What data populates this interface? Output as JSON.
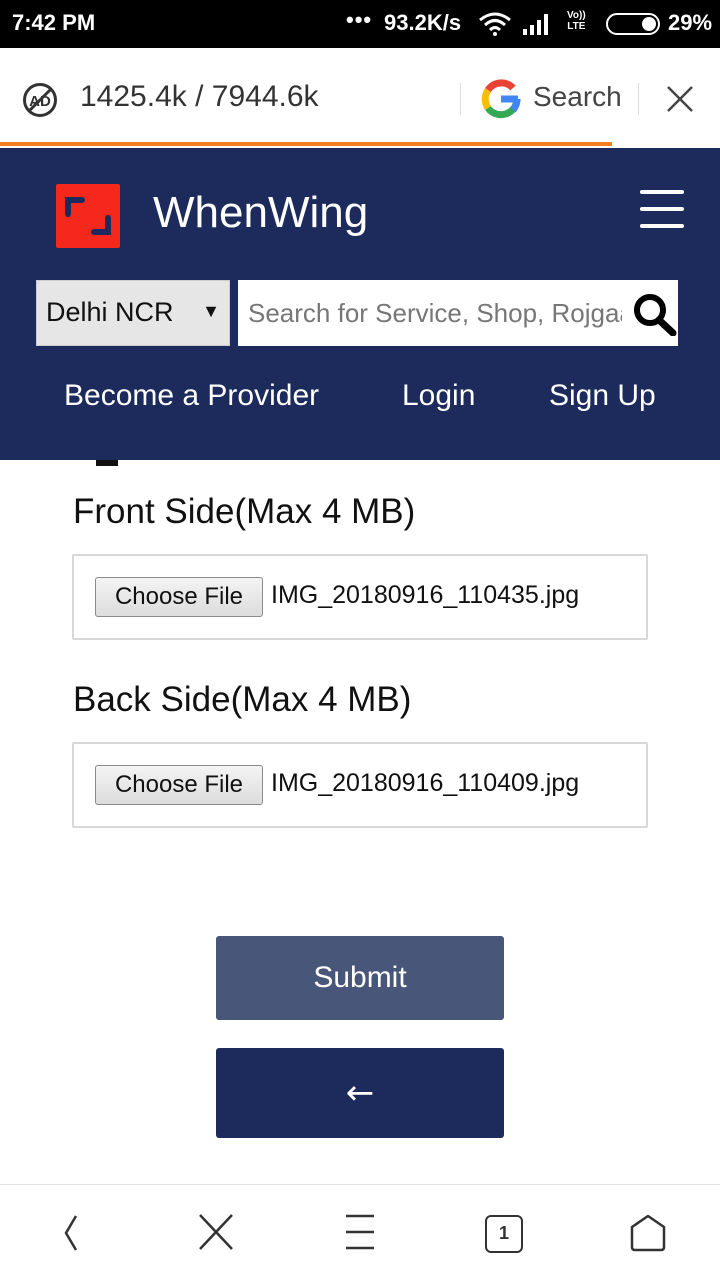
{
  "status_bar": {
    "time": "7:42 PM",
    "dots": "•••",
    "speed": "93.2K/s",
    "volte_line1": "Vo))",
    "volte_line2": "LTE",
    "battery": "29%"
  },
  "browser_bar": {
    "data_counter": "1425.4k / 7944.6k",
    "search_label": "Search",
    "progress": 0.85,
    "accent_color": "#f47e20"
  },
  "site_header": {
    "brand": "WhenWing",
    "logo_color": "#f6281b",
    "background_color": "#1c2b5c",
    "city_select": "Delhi NCR",
    "search_placeholder": "Search for Service, Shop, Rojgaar",
    "nav": {
      "become_provider": "Become a Provider",
      "login": "Login",
      "sign_up": "Sign Up"
    }
  },
  "form": {
    "front_label": "Front Side(Max 4 MB)",
    "front_button": "Choose File",
    "front_file": "IMG_20180916_110435.jpg",
    "back_label": "Back Side(Max 4 MB)",
    "back_button": "Choose File",
    "back_file": "IMG_20180916_110409.jpg",
    "submit_label": "Submit",
    "back_arrow": "←"
  },
  "bottom_nav": {
    "tab_count": "1"
  }
}
